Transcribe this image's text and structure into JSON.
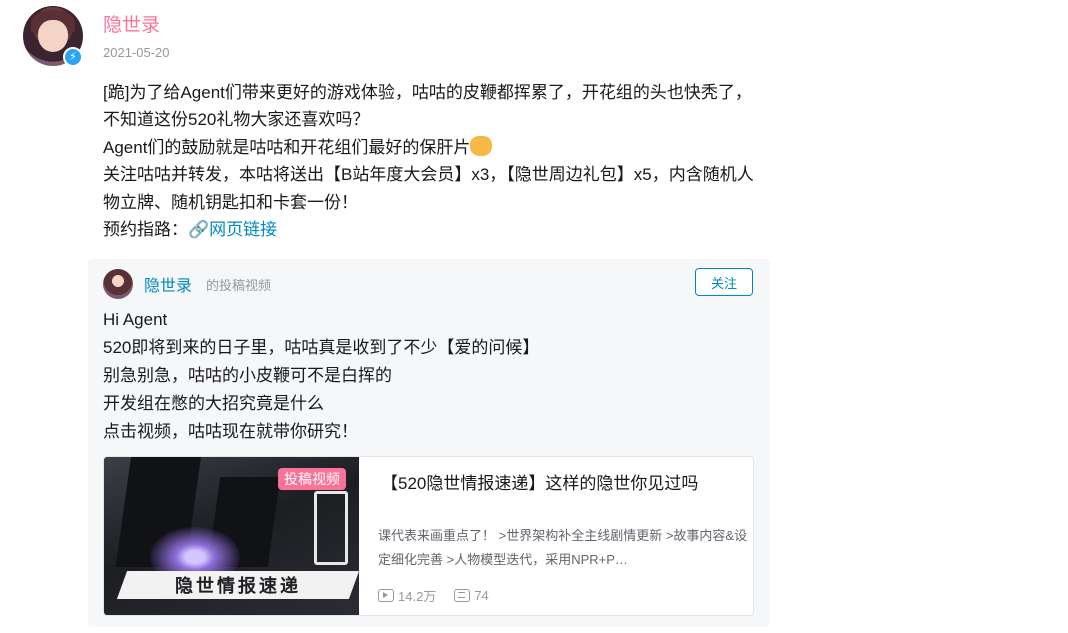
{
  "post": {
    "author": "隐世录",
    "date": "2021-05-20",
    "lines": [
      "[跪]为了给Agent们带来更好的游戏体验，咕咕的皮鞭都挥累了，开花组的头也快秃了，不知道这份520礼物大家还喜欢吗？",
      "Agent们的鼓励就是咕咕和开花组们最好的保肝片",
      "关注咕咕并转发，本咕将送出【B站年度大会员】x3，【隐世周边礼包】x5，内含随机人物立牌、随机钥匙扣和卡套一份！"
    ],
    "guide_prefix": "预约指路：",
    "link_text": "网页链接",
    "verified_badge_icon": "lightning-icon",
    "emoji_icon": "cat-emoji-icon"
  },
  "repost": {
    "author": "隐世录",
    "type_label": "的投稿视频",
    "follow_label": "关注",
    "lines": [
      "Hi Agent",
      "520即将到来的日子里，咕咕真是收到了不少【爱的问候】",
      "别急别急，咕咕的小皮鞭可不是白挥的",
      "开发组在憋的大招究竟是什么",
      "点击视频，咕咕现在就带你研究！"
    ],
    "video": {
      "tag": "投稿视频",
      "thumb_banner": "隐世情报速递",
      "title": "【520隐世情报速递】这样的隐世你见过吗",
      "desc": "课代表来画重点了！ >世界架构补全主线剧情更新 >故事内容&设定细化完善 >人物模型迭代，采用NPR+P…",
      "views": "14.2万",
      "danmaku": "74"
    }
  },
  "colors": {
    "author_pink": "#fb7299",
    "link_blue": "#008ac5",
    "badge_blue": "#2ba4f1"
  }
}
